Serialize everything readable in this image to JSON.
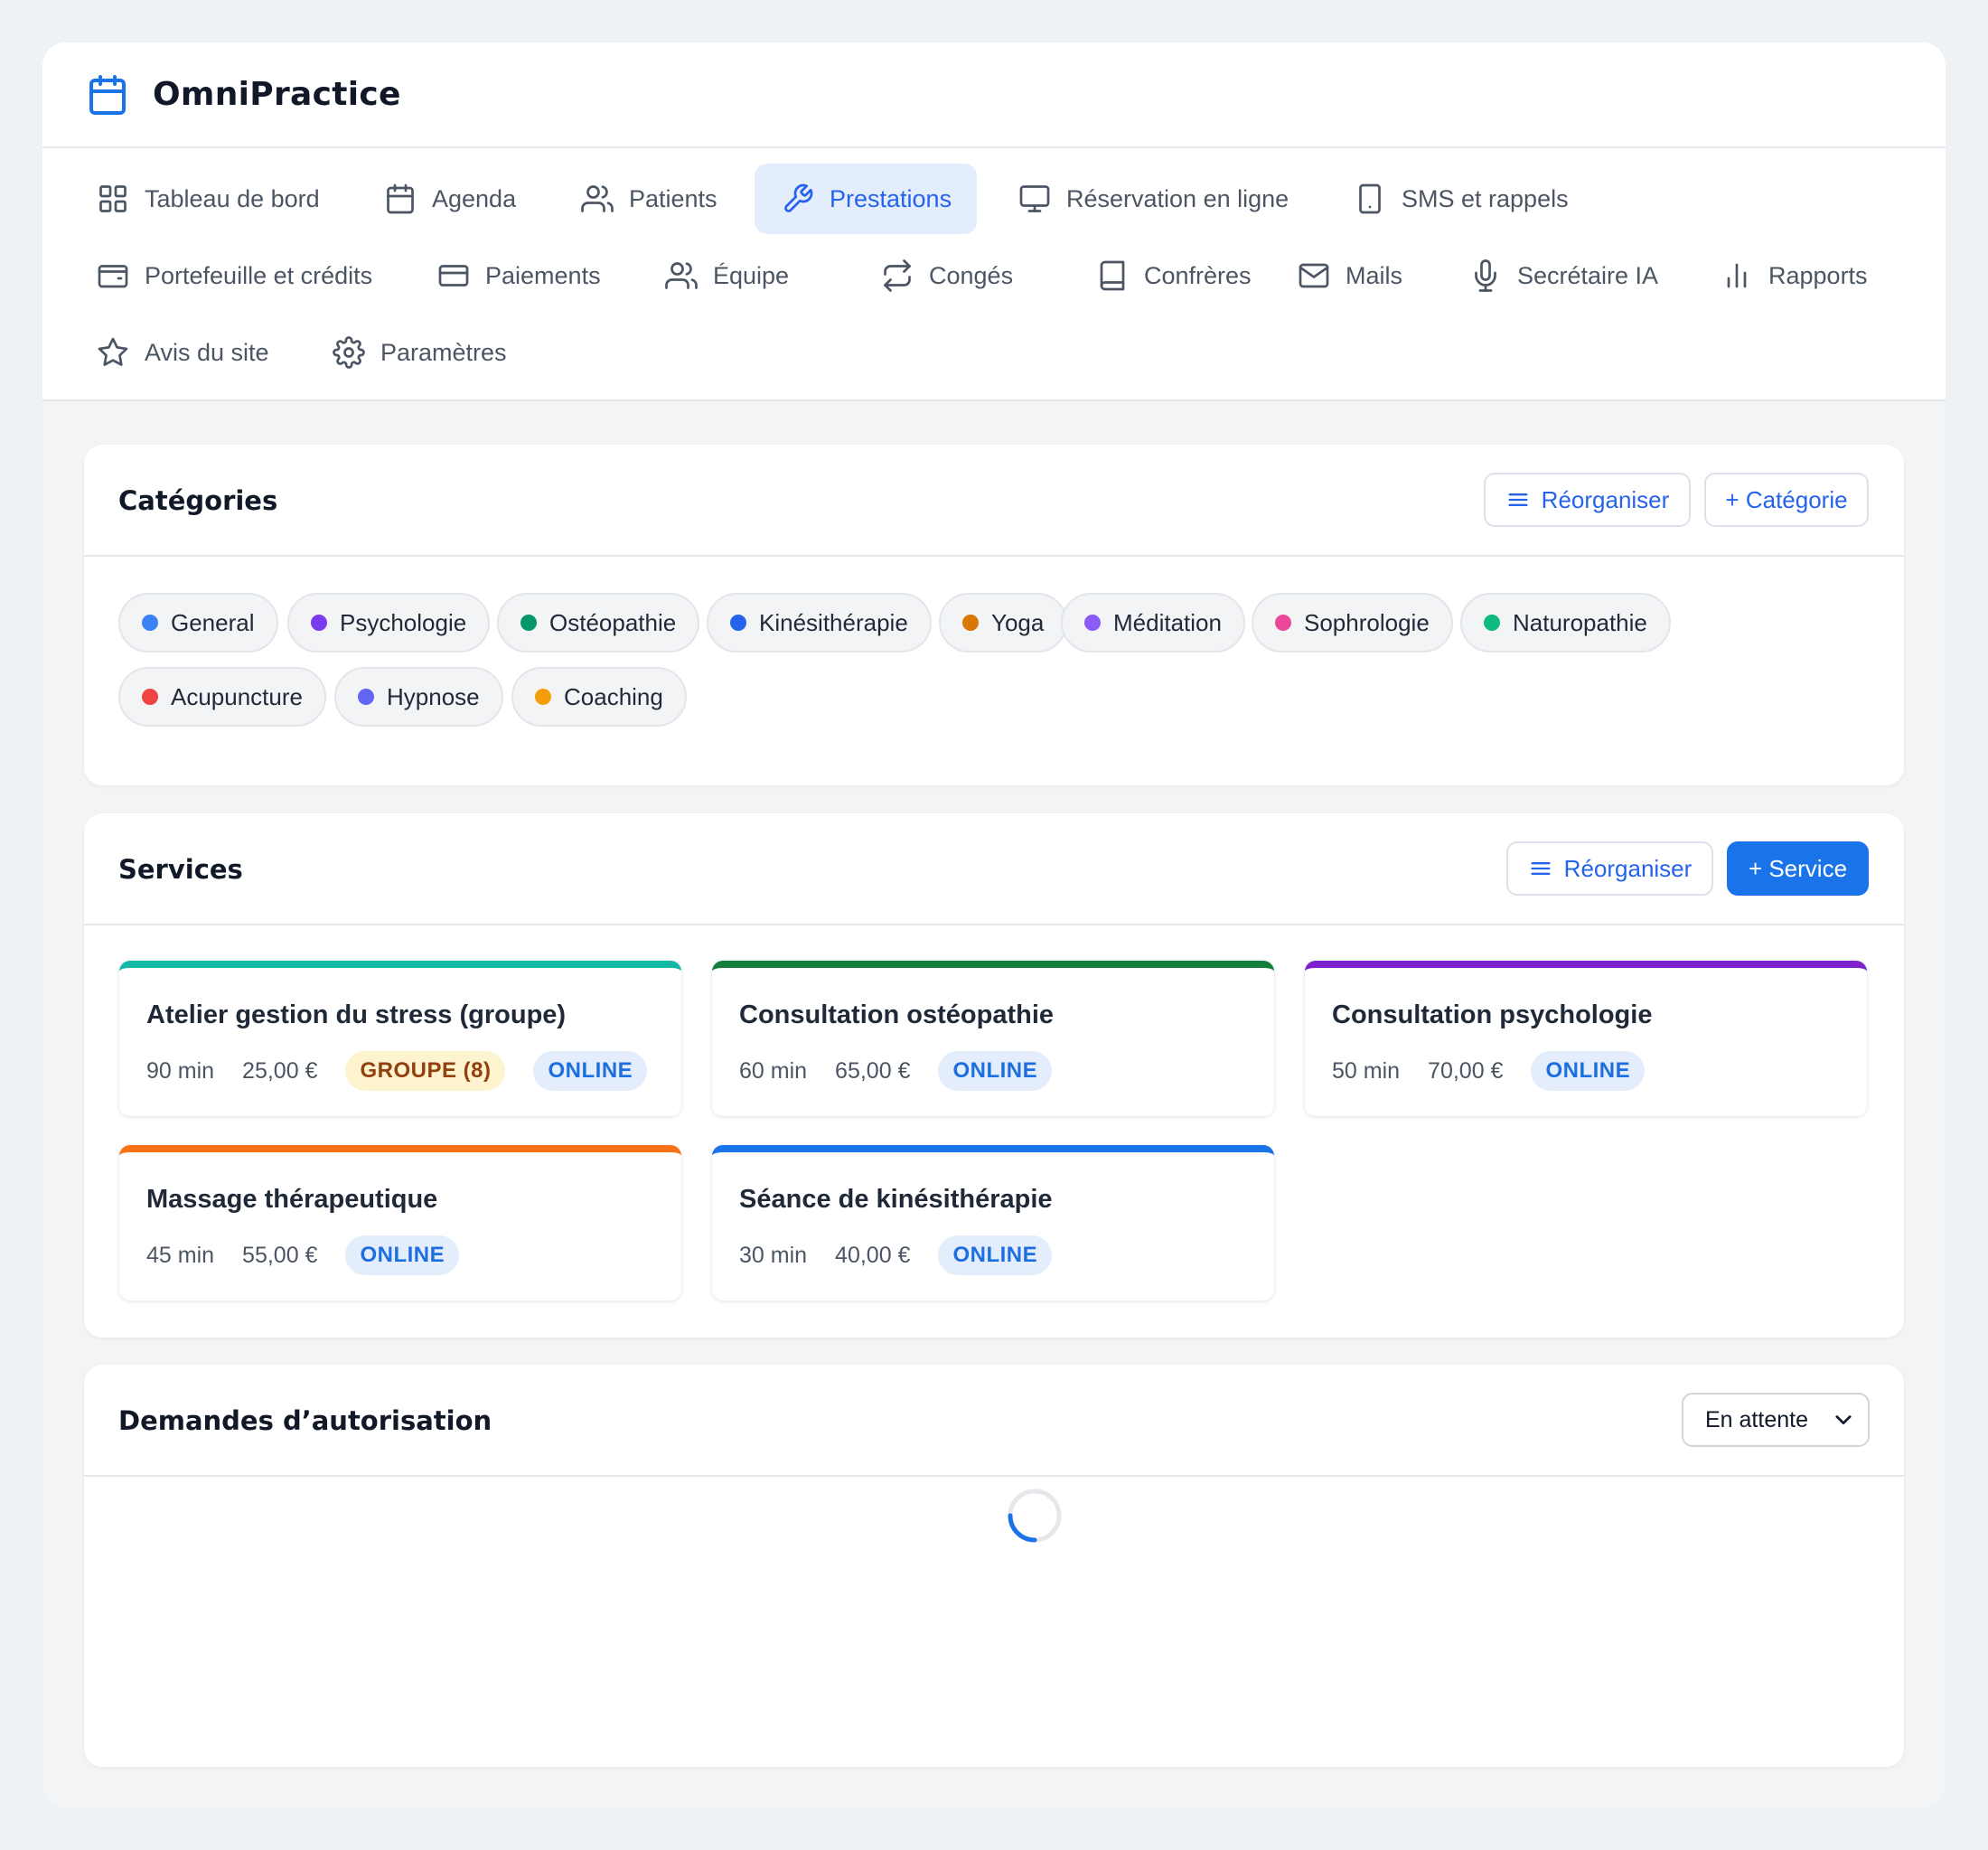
{
  "app": {
    "name": "OmniPractice"
  },
  "nav": [
    {
      "label": "Tableau de bord",
      "icon": "dashboard-grid-icon"
    },
    {
      "label": "Agenda",
      "icon": "calendar-icon"
    },
    {
      "label": "Patients",
      "icon": "users-icon"
    },
    {
      "label": "Prestations",
      "icon": "wrench-icon",
      "active": true
    },
    {
      "label": "Réservation en ligne",
      "icon": "monitor-icon"
    },
    {
      "label": "SMS et rappels",
      "icon": "smartphone-icon"
    },
    {
      "label": "Portefeuille et crédits",
      "icon": "wallet-icon"
    },
    {
      "label": "Paiements",
      "icon": "credit-card-icon"
    },
    {
      "label": "Équipe",
      "icon": "team-icon"
    },
    {
      "label": "Congés",
      "icon": "repeat-icon"
    },
    {
      "label": "Confrères",
      "icon": "book-icon"
    },
    {
      "label": "Mails",
      "icon": "mail-icon"
    },
    {
      "label": "Secrétaire IA",
      "icon": "microphone-icon"
    },
    {
      "label": "Rapports",
      "icon": "bar-chart-icon"
    },
    {
      "label": "Avis du site",
      "icon": "star-icon"
    },
    {
      "label": "Paramètres",
      "icon": "settings-gear-icon"
    }
  ],
  "categories": {
    "title": "Catégories",
    "reorder_label": "Réorganiser",
    "add_label": "+ Catégorie",
    "items": [
      {
        "label": "General",
        "color": "#3b82f6"
      },
      {
        "label": "Psychologie",
        "color": "#7c3aed"
      },
      {
        "label": "Ostéopathie",
        "color": "#059669"
      },
      {
        "label": "Kinésithérapie",
        "color": "#2563eb"
      },
      {
        "label": "Yoga",
        "color": "#d97706"
      },
      {
        "label": "Méditation",
        "color": "#8b5cf6"
      },
      {
        "label": "Sophrologie",
        "color": "#ec4899"
      },
      {
        "label": "Naturopathie",
        "color": "#10b981"
      },
      {
        "label": "Acupuncture",
        "color": "#ef4444"
      },
      {
        "label": "Hypnose",
        "color": "#6366f1"
      },
      {
        "label": "Coaching",
        "color": "#f59e0b"
      }
    ]
  },
  "services": {
    "title": "Services",
    "reorder_label": "Réorganiser",
    "add_label": "+ Service",
    "items": [
      {
        "name": "Atelier gestion du stress (groupe)",
        "duration": "90 min",
        "price": "25,00 €",
        "group_badge": "GROUPE (8)",
        "online_badge": "ONLINE",
        "color": "#14b8a6"
      },
      {
        "name": "Consultation ostéopathie",
        "duration": "60 min",
        "price": "65,00 €",
        "online_badge": "ONLINE",
        "color": "#15803d"
      },
      {
        "name": "Consultation psychologie",
        "duration": "50 min",
        "price": "70,00 €",
        "online_badge": "ONLINE",
        "color": "#7e22ce"
      },
      {
        "name": "Massage thérapeutique",
        "duration": "45 min",
        "price": "55,00 €",
        "online_badge": "ONLINE",
        "color": "#f97316"
      },
      {
        "name": "Séance de kinésithérapie",
        "duration": "30 min",
        "price": "40,00 €",
        "online_badge": "ONLINE",
        "color": "#1a73e8"
      }
    ]
  },
  "requests": {
    "title": "Demandes d’autorisation",
    "filter_value": "En attente",
    "loading": true
  },
  "colors": {
    "accent": "#1a73e8",
    "active_nav_bg": "#e3edfc"
  }
}
